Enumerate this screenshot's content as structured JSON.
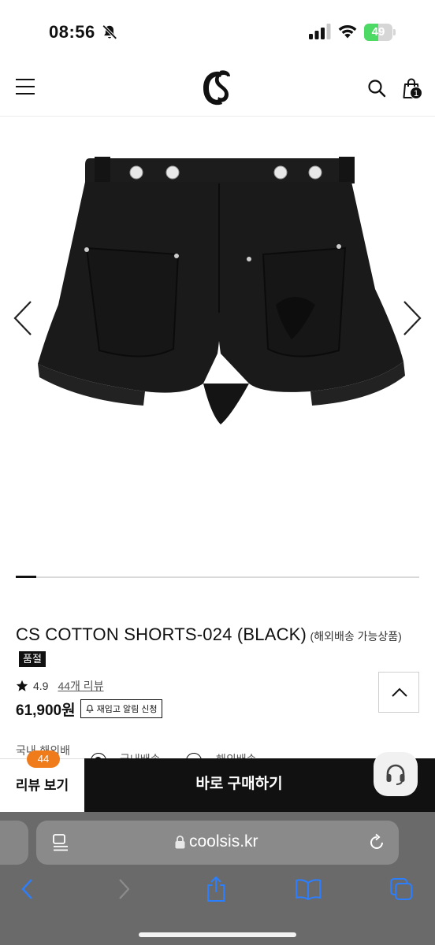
{
  "status_bar": {
    "time": "08:56",
    "battery_level": "49",
    "battery_fraction": 0.49,
    "icons": [
      "bell-off-icon",
      "signal-icon",
      "wifi-icon",
      "battery-icon"
    ]
  },
  "header": {
    "icons": [
      "hamburger-menu-icon",
      "brand-logo",
      "search-icon",
      "shopping-bag-icon"
    ],
    "cart_count": "1"
  },
  "gallery": {
    "slide_progress": 0.05,
    "icons": [
      "chevron-left-icon",
      "chevron-right-icon"
    ]
  },
  "product": {
    "title": "CS COTTON SHORTS-024 (BLACK)",
    "subtitle": "(해외배송 가능상품)",
    "soldout_label": "품절",
    "rating": "4.9",
    "review_link": "44개 리뷰",
    "price": "61,900원",
    "restock_label": "재입고 알림 신청"
  },
  "shipping": {
    "label": "국내·해외배",
    "options": [
      "국내배송",
      "해외배송"
    ],
    "selected": "국내배송"
  },
  "action_bar": {
    "review_button": "리뷰 보기",
    "review_count": "44",
    "buy_button": "바로 구매하기"
  },
  "safari": {
    "url": "coolsis.kr",
    "icons": [
      "reader-icon",
      "lock-icon",
      "reload-icon",
      "back-icon",
      "forward-icon",
      "share-icon",
      "bookmarks-icon",
      "tabs-icon"
    ]
  },
  "colors": {
    "accent_badge": "#f07b1a",
    "battery_green": "#4cd964",
    "primary": "#111111"
  }
}
